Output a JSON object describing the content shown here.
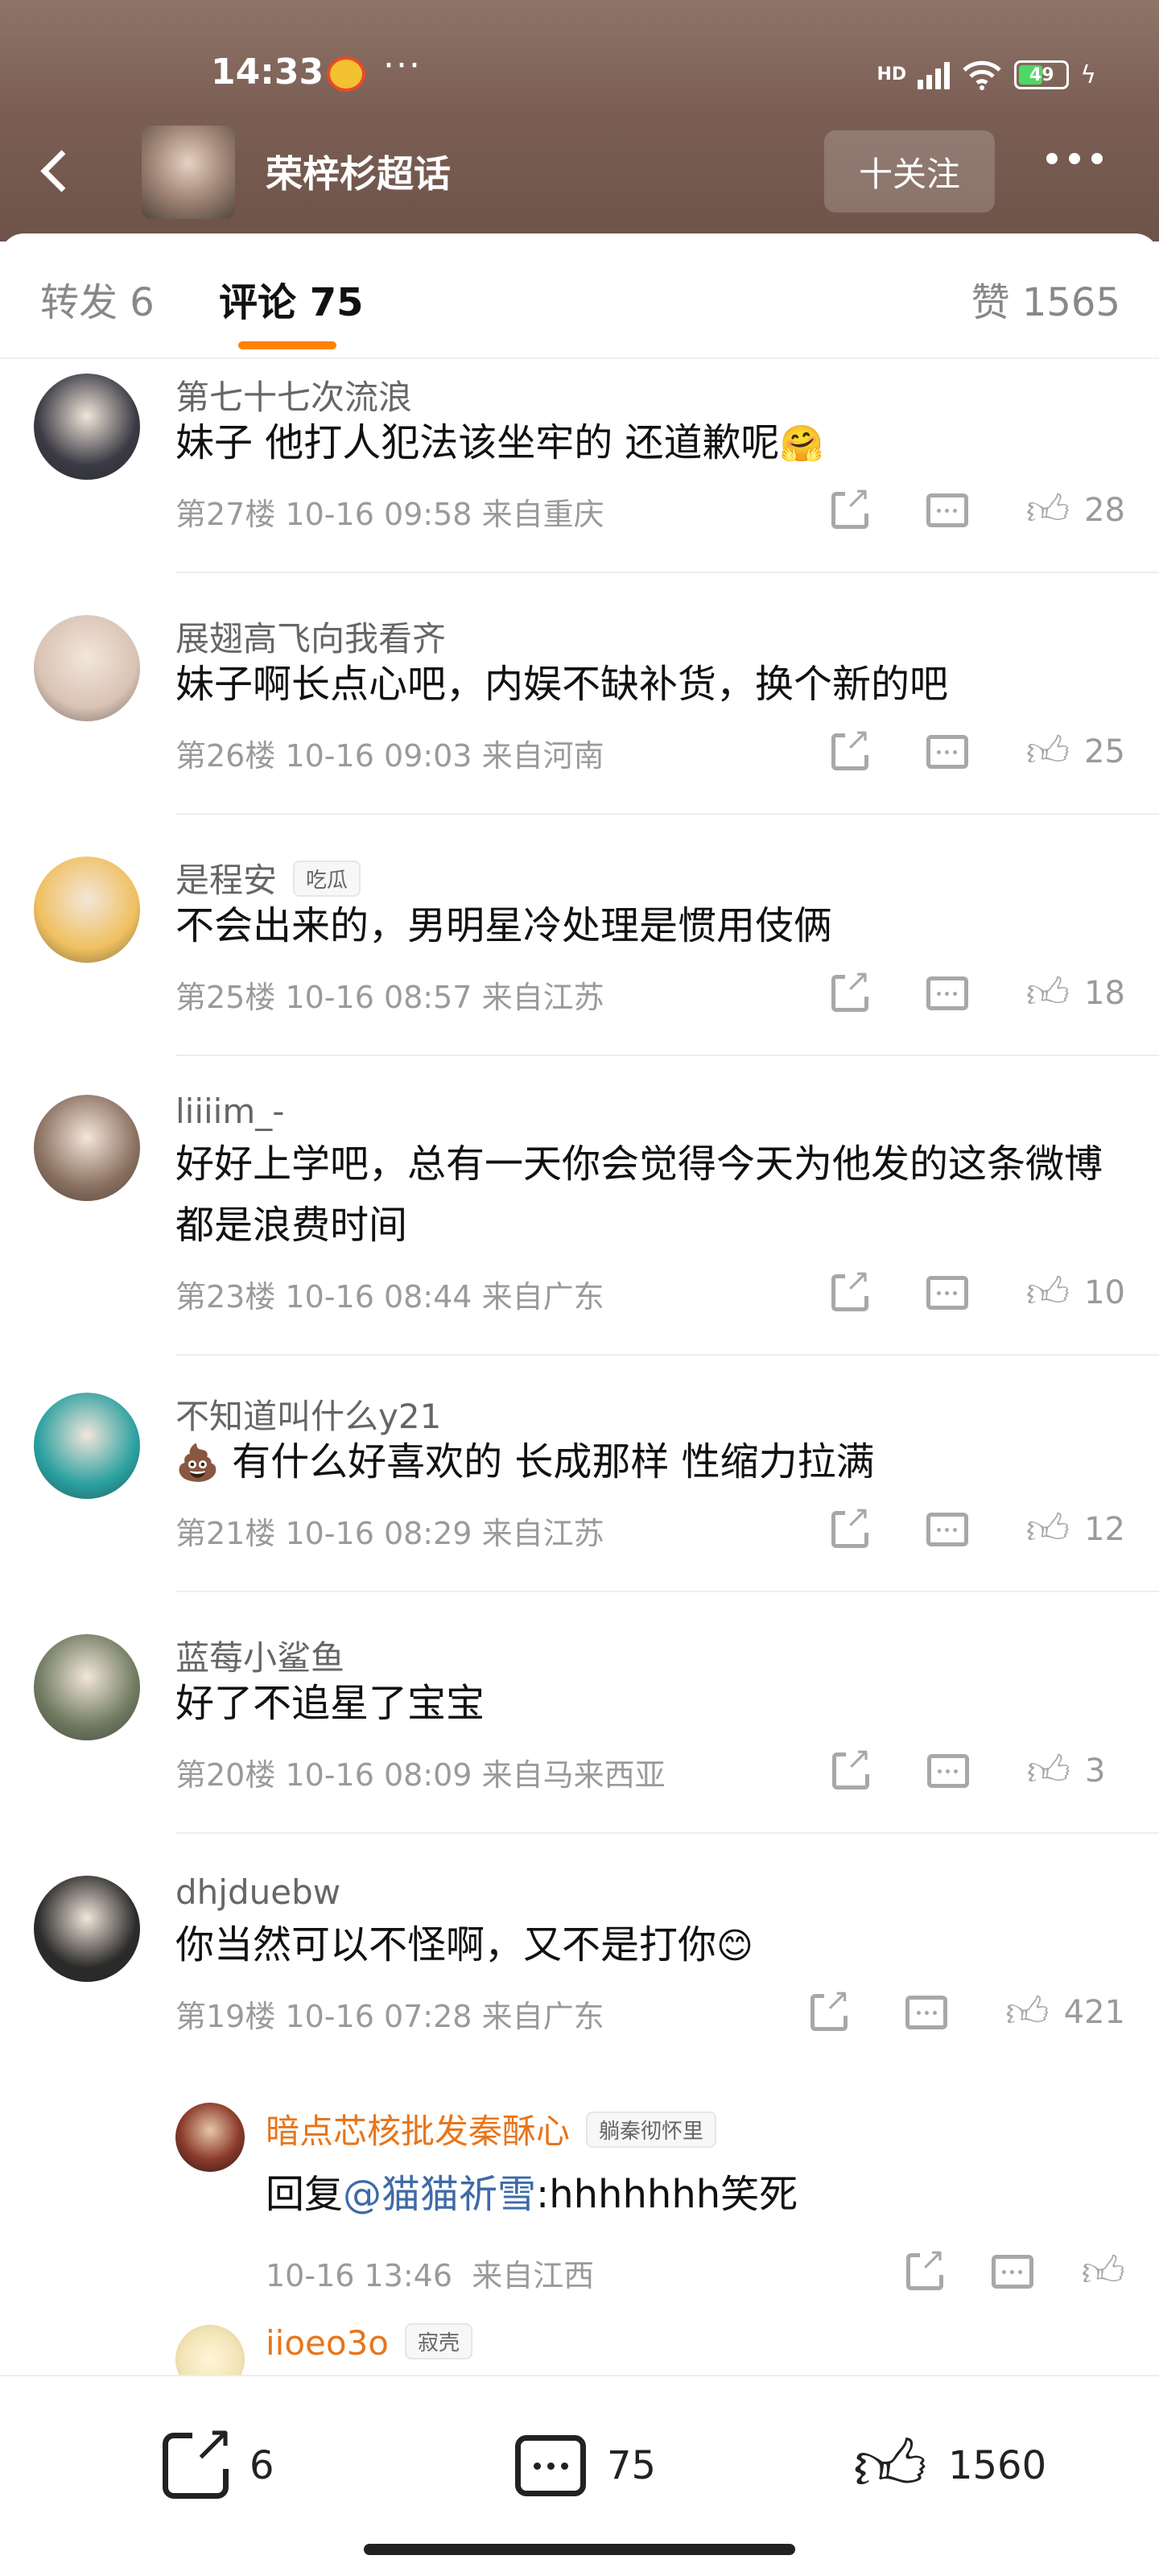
{
  "status_bar": {
    "time": "14:33",
    "dots": "···",
    "network": "HD",
    "battery": "49",
    "icons": [
      "weibo-notification-icon",
      "signal-icon",
      "wifi-icon",
      "battery-icon",
      "charging-icon"
    ]
  },
  "nav": {
    "title": "荣梓杉超话",
    "follow_label": "十关注"
  },
  "tabs": {
    "repost": "转发 6",
    "comments": "评论 75",
    "likes": "赞 1565"
  },
  "comments": [
    {
      "name": "第七十七次流浪",
      "text": "妹子 他打人犯法该坐牢的 还道歉呢",
      "emoji": "🤗",
      "floor": "第27楼",
      "time": "10-16 09:58",
      "location": "来自重庆",
      "likes": "28",
      "avatar_color": "#3a3a44"
    },
    {
      "name": "展翅高飞向我看齐",
      "text": "妹子啊长点心吧，内娱不缺补货，换个新的吧",
      "floor": "第26楼",
      "time": "10-16 09:03",
      "location": "来自河南",
      "likes": "25",
      "avatar_color": "#d9c3b5"
    },
    {
      "name": "是程安",
      "badge": "吃瓜",
      "text": "不会出来的，男明星冷处理是惯用伎俩",
      "floor": "第25楼",
      "time": "10-16 08:57",
      "location": "来自江苏",
      "likes": "18",
      "avatar_color": "#f0c060"
    },
    {
      "name": "liiiim_-",
      "text": "好好上学吧，总有一天你会觉得今天为他发的这条微博都是浪费时间",
      "floor": "第23楼",
      "time": "10-16 08:44",
      "location": "来自广东",
      "likes": "10",
      "avatar_color": "#8a7060"
    },
    {
      "name": "不知道叫什么y21",
      "emoji_prefix": "💩",
      "text": "有什么好喜欢的 长成那样 性缩力拉满",
      "floor": "第21楼",
      "time": "10-16 08:29",
      "location": "来自江苏",
      "likes": "12",
      "avatar_color": "#2aa0a0"
    },
    {
      "name": "蓝莓小鲨鱼",
      "text": "好了不追星了宝宝",
      "floor": "第20楼",
      "time": "10-16 08:09",
      "location": "来自马来西亚",
      "likes": "3",
      "avatar_color": "#6f7a60"
    },
    {
      "name": "dhjduebw",
      "text": "你当然可以不怪啊，又不是打你",
      "emoji": "😊",
      "floor": "第19楼",
      "time": "10-16 07:28",
      "location": "来自广东",
      "likes": "421",
      "avatar_color": "#2b2b2b"
    }
  ],
  "sub_reply": {
    "name": "暗点芯核批发秦酥心",
    "badge": "躺秦彻怀里",
    "reply_prefix": "回复",
    "mention": "@猫猫祈雪",
    "text": ":hhhhhhh笑死",
    "time": "10-16 13:46",
    "location": "来自江西"
  },
  "sub_reply_2": {
    "name": "iioeo3o",
    "badge": "寂壳"
  },
  "bottom_bar": {
    "share_count": "6",
    "comment_count": "75",
    "like_count": "1560"
  }
}
